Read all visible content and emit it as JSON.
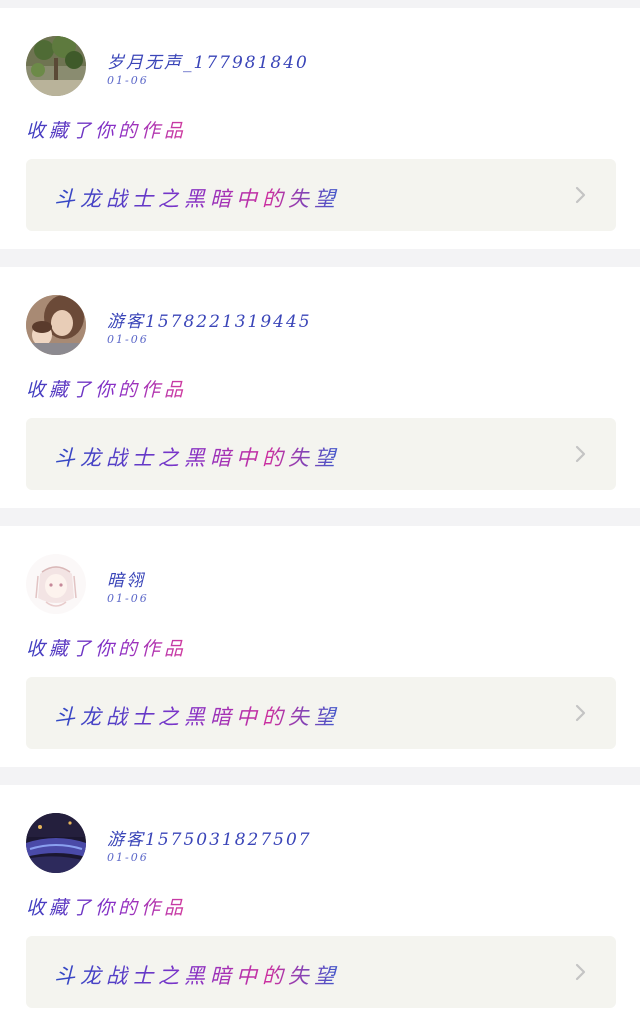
{
  "feed": {
    "items": [
      {
        "username": "岁月无声_177981840",
        "date": "01-06",
        "action": "收藏了你的作品",
        "work_title": "斗龙战士之黑暗中的失望",
        "avatar_icon": "avatar-plant-photo"
      },
      {
        "username": "游客1578221319445",
        "date": "01-06",
        "action": "收藏了你的作品",
        "work_title": "斗龙战士之黑暗中的失望",
        "avatar_icon": "avatar-portrait-photo"
      },
      {
        "username": "暗翎",
        "date": "01-06",
        "action": "收藏了你的作品",
        "work_title": "斗龙战士之黑暗中的失望",
        "avatar_icon": "avatar-anime-sketch"
      },
      {
        "username": "游客1575031827507",
        "date": "01-06",
        "action": "收藏了你的作品",
        "work_title": "斗龙战士之黑暗中的失望",
        "avatar_icon": "avatar-night-scene"
      }
    ]
  },
  "colors": {
    "page_background": "#f3f3f5",
    "card_background": "#ffffff",
    "link_background": "#f4f4ef",
    "username_color": "#3a45b8",
    "chevron_color": "#c4c4c4"
  }
}
